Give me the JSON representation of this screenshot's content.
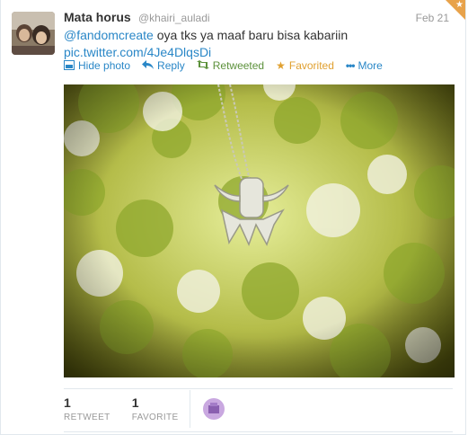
{
  "user": {
    "name": "Mata horus",
    "handle": "@khairi_auladi"
  },
  "tweet": {
    "date": "Feb 21",
    "mention": "@fandomcreate",
    "body": " oya tks ya maaf baru bisa kabariin",
    "link": "pic.twitter.com/4Je4DlqsDi"
  },
  "actions": {
    "hide_photo": "Hide photo",
    "reply": "Reply",
    "retweeted": "Retweeted",
    "favorited": "Favorited",
    "more": "More"
  },
  "stats": {
    "retweet_count": "1",
    "retweet_label": "RETWEET",
    "favorite_count": "1",
    "favorite_label": "FAVORITE"
  },
  "colors": {
    "link": "#2a87c7",
    "retweeted": "#5c913b",
    "favorited": "#e0a030",
    "corner": "#e8a24a"
  },
  "icons": [
    "photo-icon",
    "reply-icon",
    "retweet-icon",
    "star-icon",
    "more-icon"
  ]
}
